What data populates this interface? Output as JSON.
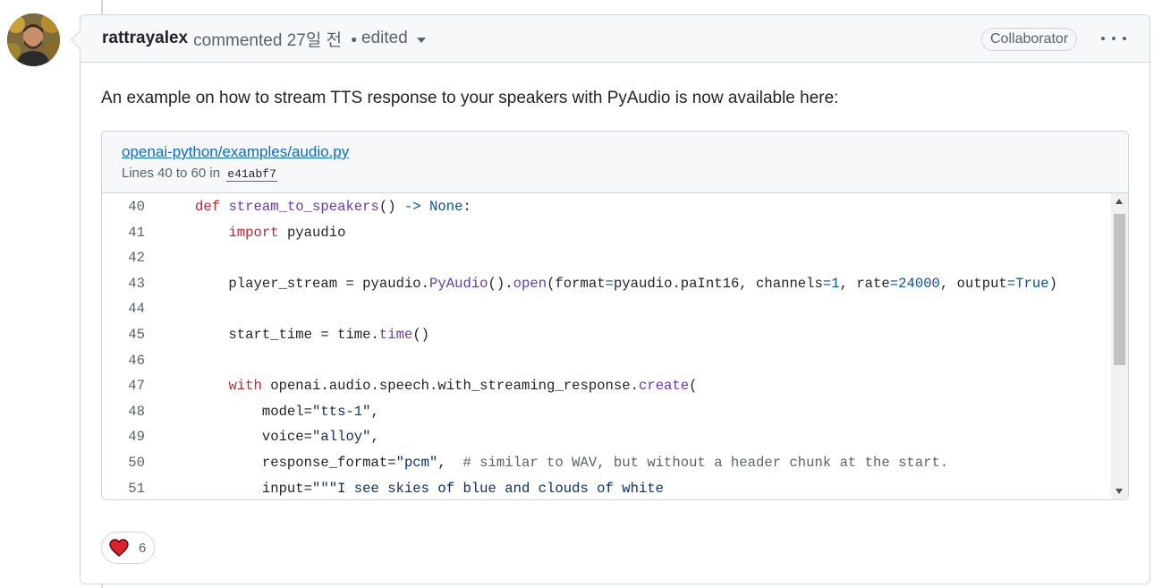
{
  "comment": {
    "author": "rattrayalex",
    "action": "commented",
    "time": "27일 전",
    "separator": "•",
    "edited_label": "edited",
    "role_badge": "Collaborator",
    "body": "An example on how to stream TTS response to your speakers with PyAudio is now available here:"
  },
  "snippet": {
    "file_link": "openai-python/examples/audio.py",
    "lines_prefix": "Lines 40 to 60 in",
    "commit": "e41abf7",
    "lines": [
      {
        "num": "40",
        "code": "def stream_to_speakers() -> None:"
      },
      {
        "num": "41",
        "code": "    import pyaudio"
      },
      {
        "num": "42",
        "code": ""
      },
      {
        "num": "43",
        "code": "    player_stream = pyaudio.PyAudio().open(format=pyaudio.paInt16, channels=1, rate=24000, output=True)"
      },
      {
        "num": "44",
        "code": ""
      },
      {
        "num": "45",
        "code": "    start_time = time.time()"
      },
      {
        "num": "46",
        "code": ""
      },
      {
        "num": "47",
        "code": "    with openai.audio.speech.with_streaming_response.create("
      },
      {
        "num": "48",
        "code": "        model=\"tts-1\","
      },
      {
        "num": "49",
        "code": "        voice=\"alloy\","
      },
      {
        "num": "50",
        "code": "        response_format=\"pcm\",  # similar to WAV, but without a header chunk at the start."
      },
      {
        "num": "51",
        "code": "        input=\"\"\"I see skies of blue and clouds of white"
      }
    ]
  },
  "reactions": [
    {
      "icon": "heart-icon",
      "count": "6"
    }
  ],
  "colors": {
    "link": "#0969da",
    "keyword": "#cf222e",
    "function": "#6639ba",
    "constant": "#0550ae",
    "string": "#0a3069",
    "comment": "#59636e",
    "heart": "#e0202a"
  }
}
